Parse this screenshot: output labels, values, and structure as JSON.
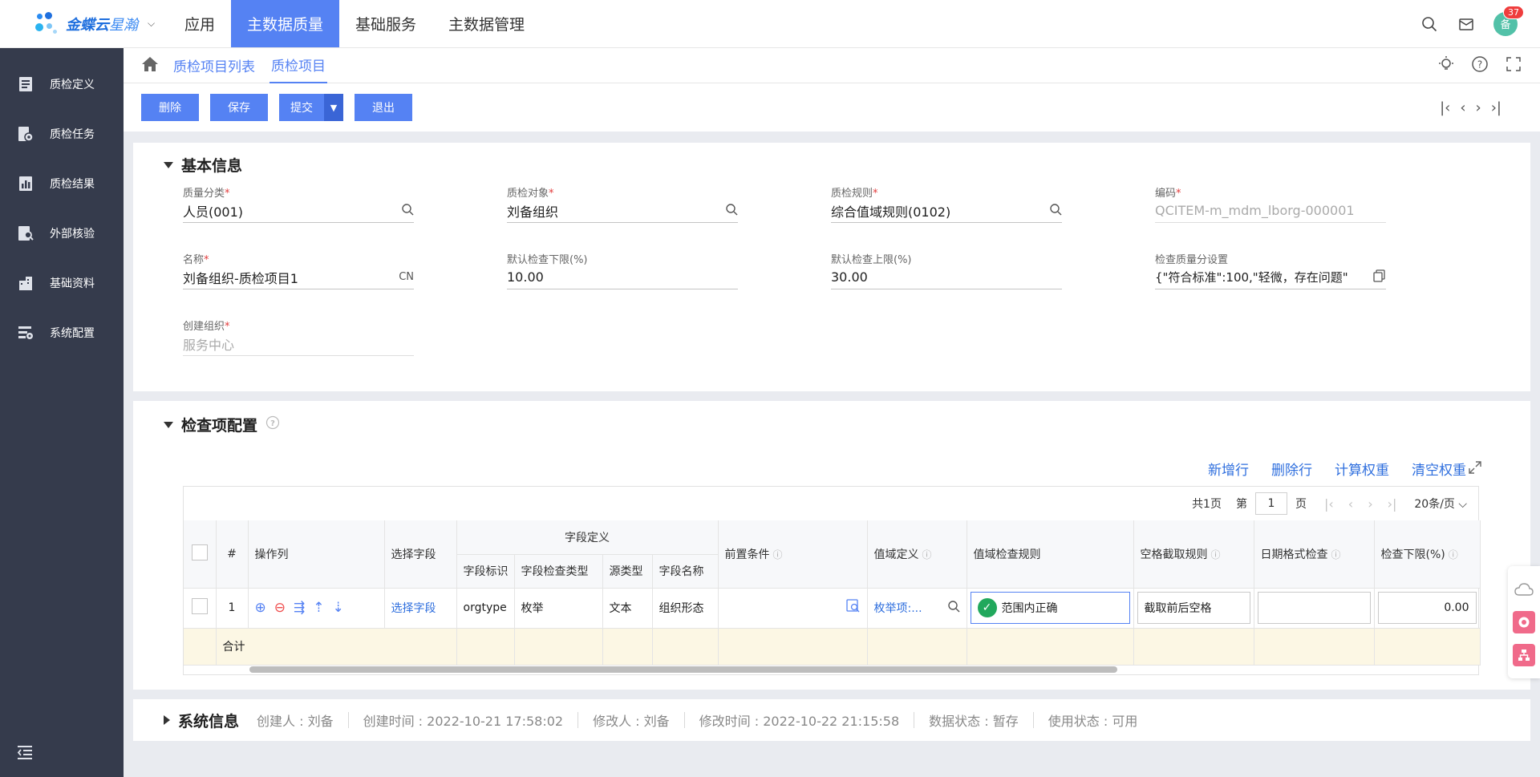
{
  "app": {
    "brand_name": "金蝶云",
    "brand_sub": "星瀚",
    "notification_count": "37",
    "avatar_text": "备"
  },
  "topnav": {
    "items": [
      {
        "label": "应用"
      },
      {
        "label": "主数据质量"
      },
      {
        "label": "基础服务"
      },
      {
        "label": "主数据管理"
      }
    ],
    "active_index": 1
  },
  "sidebar": {
    "items": [
      {
        "label": "质检定义",
        "icon": "book-icon"
      },
      {
        "label": "质检任务",
        "icon": "task-gear-icon"
      },
      {
        "label": "质检结果",
        "icon": "chart-doc-icon"
      },
      {
        "label": "外部核验",
        "icon": "search-doc-icon"
      },
      {
        "label": "基础资料",
        "icon": "building-icon"
      },
      {
        "label": "系统配置",
        "icon": "config-icon"
      }
    ]
  },
  "breadcrumb": {
    "items": [
      {
        "label": "质检项目列表"
      },
      {
        "label": "质检项目"
      }
    ]
  },
  "toolbar": {
    "delete_label": "删除",
    "save_label": "保存",
    "submit_label": "提交",
    "exit_label": "退出"
  },
  "basic_info": {
    "title": "基本信息",
    "fields": {
      "category": {
        "label": "质量分类",
        "value": "人员(001)"
      },
      "object": {
        "label": "质检对象",
        "value": "刘备组织"
      },
      "rule": {
        "label": "质检规则",
        "value": "综合值域规则(0102)"
      },
      "code": {
        "label": "编码",
        "value": "QCITEM-m_mdm_lborg-000001"
      },
      "name": {
        "label": "名称",
        "value": "刘备组织-质检项目1",
        "suffix": "CN"
      },
      "lower": {
        "label": "默认检查下限(%)",
        "value": "10.00"
      },
      "upper": {
        "label": "默认检查上限(%)",
        "value": "30.00"
      },
      "score": {
        "label": "检查质量分设置",
        "value": "{\"符合标准\":100,\"轻微，存在问题\""
      },
      "org": {
        "label": "创建组织",
        "value": "服务中心"
      }
    }
  },
  "check_config": {
    "title": "检查项配置",
    "actions": {
      "add": "新增行",
      "delete": "删除行",
      "weight": "计算权重",
      "clear": "清空权重"
    },
    "pager": {
      "total": "共1页",
      "page_prefix": "第",
      "page": "1",
      "page_suffix": "页",
      "page_size": "20条/页"
    },
    "headers": {
      "index": "#",
      "ops": "操作列",
      "select_field": "选择字段",
      "field_def": "字段定义",
      "field_id": "字段标识",
      "field_check_type": "字段检查类型",
      "source_type": "源类型",
      "field_name": "字段名称",
      "precondition": "前置条件",
      "domain_def": "值域定义",
      "domain_rule": "值域检查规则",
      "space_rule": "空格截取规则",
      "date_check": "日期格式检查",
      "lower_limit": "检查下限(%)"
    },
    "rows": [
      {
        "index": "1",
        "select_field": "选择字段",
        "field_id": "orgtype",
        "field_check_type": "枚举",
        "source_type": "文本",
        "field_name": "组织形态",
        "domain_def": "枚举项:...",
        "domain_rule": "范围内正确",
        "space_rule": "截取前后空格",
        "date_check": "",
        "lower_limit": "0.00"
      }
    ],
    "sum_label": "合计"
  },
  "system_info": {
    "title": "系统信息",
    "creator": "创建人 : 刘备",
    "created": "创建时间 : 2022-10-21 17:58:02",
    "modifier": "修改人 : 刘备",
    "modified": "修改时间 : 2022-10-22 21:15:58",
    "data_status": "数据状态 : 暂存",
    "use_status": "使用状态 : 可用"
  },
  "colors": {
    "primary": "#5582f3",
    "sidebar": "#353b4c",
    "link": "#2f6fde",
    "sum_row": "#fcf7e4"
  }
}
